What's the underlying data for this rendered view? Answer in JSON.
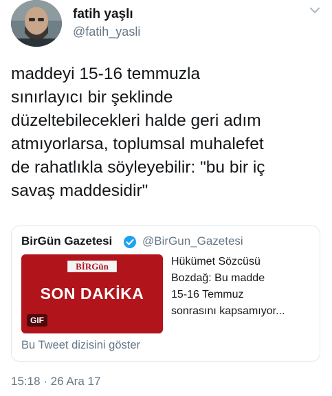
{
  "author": {
    "display_name": "fatih yaşlı",
    "handle": "@fatih_yasli"
  },
  "tweet": {
    "text": "maddeyi 15-16 temmuzla\nsınırlayıcı bir şeklinde\ndüzeltebilecekleri halde geri adım\natmıyorlarsa, toplumsal muhalefet\nde rahatlıkla söyleyebilir: \"bu bir iç\nsavaş maddesidir\"",
    "timestamp": "15:18 · 26 Ara 17"
  },
  "quoted_tweet": {
    "display_name": "BirGün Gazetesi",
    "handle": "@BirGun_Gazetesi",
    "media": {
      "logo_text": "BİRGün",
      "headline": "SON DAKİKA",
      "badge": "GIF"
    },
    "text": "Hükümet Sözcüsü\nBozdağ: Bu madde\n15-16 Temmuz\nsonrasını kapsamıyor...",
    "thread_link": "Bu Tweet dizisini göster"
  },
  "icons": {
    "menu": "chevron-down-icon",
    "verified": "verified-badge-icon"
  },
  "colors": {
    "text": "#14171a",
    "secondary": "#657786",
    "verified": "#1da1f2",
    "media_red": "#b1141a",
    "border": "#e1e8ed"
  }
}
